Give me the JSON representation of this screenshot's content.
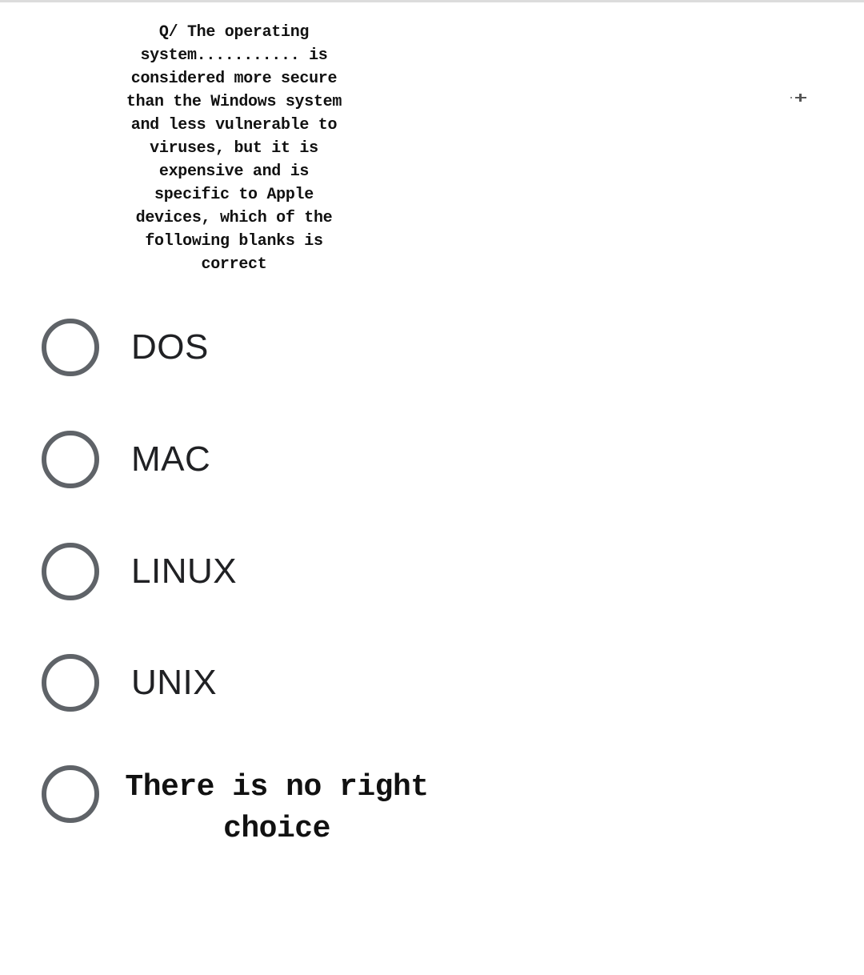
{
  "question": {
    "text": "Q/ The operating\nsystem........... is\nconsidered more secure\nthan the Windows system\nand less vulnerable to\nviruses, but it is\nexpensive and is\nspecific to Apple\ndevices, which of the\nfollowing blanks is\ncorrect"
  },
  "options": [
    {
      "label": "DOS",
      "selected": false
    },
    {
      "label": "MAC",
      "selected": false
    },
    {
      "label": "LINUX",
      "selected": false
    },
    {
      "label": "UNIX",
      "selected": false
    },
    {
      "label": "There is no right\nchoice",
      "selected": false
    }
  ],
  "colors": {
    "radio_border": "#5f6368",
    "text": "#202124"
  },
  "icons": {
    "cursor": "move-cursor-icon",
    "radio": "radio-unchecked-icon"
  }
}
